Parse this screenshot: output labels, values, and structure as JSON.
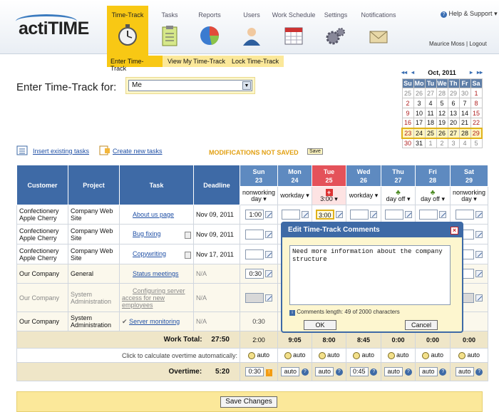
{
  "app": {
    "logo": "actiTIME"
  },
  "nav": {
    "tabs": [
      {
        "label": "Time-Track",
        "icon": "stopwatch-icon"
      },
      {
        "label": "Tasks",
        "icon": "clipboard-icon"
      },
      {
        "label": "Reports",
        "icon": "pie-chart-icon"
      },
      {
        "label": "Users",
        "icon": "user-icon"
      },
      {
        "label": "Work Schedule",
        "icon": "calendar-icon"
      },
      {
        "label": "Settings",
        "icon": "gears-icon"
      },
      {
        "label": "Notifications",
        "icon": "envelope-icon"
      }
    ],
    "subtabs": [
      "Enter Time-Track",
      "View My Time-Track",
      "Lock Time-Track"
    ],
    "help": "Help & Support",
    "user_name": "Maurice Moss",
    "logout": "Logout"
  },
  "form": {
    "label": "Enter Time-Track for:",
    "user_value": "Me"
  },
  "calendar": {
    "month": "Oct, 2011",
    "weekdays": [
      "Su",
      "Mo",
      "Tu",
      "We",
      "Th",
      "Fr",
      "Sa"
    ],
    "weeks": [
      [
        "25",
        "26",
        "27",
        "28",
        "29",
        "30",
        "1"
      ],
      [
        "2",
        "3",
        "4",
        "5",
        "6",
        "7",
        "8"
      ],
      [
        "9",
        "10",
        "11",
        "12",
        "13",
        "14",
        "15"
      ],
      [
        "16",
        "17",
        "18",
        "19",
        "20",
        "21",
        "22"
      ],
      [
        "23",
        "24",
        "25",
        "26",
        "27",
        "28",
        "29"
      ],
      [
        "30",
        "31",
        "1",
        "2",
        "3",
        "4",
        "5"
      ]
    ]
  },
  "actions": {
    "insert": "Insert existing tasks",
    "create": "Create new tasks",
    "status": "MODIFICATIONS NOT SAVED",
    "status_save": "Save"
  },
  "grid": {
    "headers": {
      "customer": "Customer",
      "project": "Project",
      "task": "Task",
      "deadline": "Deadline"
    },
    "days": [
      {
        "name": "Sun",
        "date": "23",
        "type": "nonworking day"
      },
      {
        "name": "Mon",
        "date": "24",
        "type": "workday"
      },
      {
        "name": "Tue",
        "date": "25",
        "type": "3:00"
      },
      {
        "name": "Wed",
        "date": "26",
        "type": "workday"
      },
      {
        "name": "Thu",
        "date": "27",
        "type": "day off"
      },
      {
        "name": "Fri",
        "date": "28",
        "type": "day off"
      },
      {
        "name": "Sat",
        "date": "29",
        "type": "nonworking day"
      }
    ],
    "rows": [
      {
        "customer": "Confectionery Apple Cherry",
        "project": "Company Web Site",
        "task": "About us page",
        "deadline": "Nov 09, 2011",
        "times": [
          "1:00",
          "",
          "3:00",
          "",
          "",
          "",
          ""
        ]
      },
      {
        "customer": "Confectionery Apple Cherry",
        "project": "Company Web Site",
        "task": "Bug fixing",
        "deadline": "Nov 09, 2011",
        "times": [
          "",
          "",
          "",
          "",
          "",
          "",
          ""
        ]
      },
      {
        "customer": "Confectionery Apple Cherry",
        "project": "Company Web Site",
        "task": "Copywriting",
        "deadline": "Nov 17, 2011",
        "times": [
          "",
          "",
          "",
          "",
          "",
          "",
          ""
        ]
      },
      {
        "customer": "Our Company",
        "project": "General",
        "task": "Status meetings",
        "deadline": "N/A",
        "times": [
          "0:30",
          "",
          "",
          "",
          "",
          "",
          ""
        ]
      },
      {
        "customer": "Our Company",
        "project": "System Administration",
        "task": "Configuring server access for new employees",
        "deadline": "N/A",
        "times": [
          "",
          "",
          "",
          "",
          "",
          "",
          ""
        ]
      },
      {
        "customer": "Our Company",
        "project": "System Administration",
        "task": "Server monitoring",
        "deadline": "N/A",
        "times": [
          "0:30",
          "",
          "",
          "",
          "",
          "",
          ""
        ]
      }
    ],
    "work_total_label": "Work Total:",
    "work_total": "27:50",
    "day_totals": [
      "2:00",
      "9:05",
      "8:00",
      "8:45",
      "0:00",
      "0:00",
      "0:00"
    ],
    "overtime_hint": "Click to calculate overtime automatically:",
    "auto": "auto",
    "overtime_label": "Overtime:",
    "overtime_total": "5:20",
    "overtime_values": [
      "0:30",
      "auto",
      "auto",
      "0:45",
      "auto",
      "auto",
      "auto"
    ]
  },
  "dialog": {
    "title": "Edit Time-Track Comments",
    "text": "Need more information about the company structure",
    "length": "Comments length: 49 of 2000 characters",
    "ok": "OK",
    "cancel": "Cancel"
  },
  "footer": {
    "save": "Save Changes"
  }
}
